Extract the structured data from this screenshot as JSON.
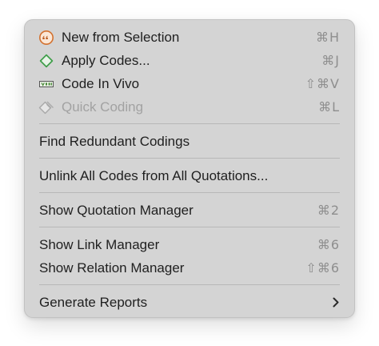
{
  "menu": {
    "items": [
      {
        "label": "New from Selection",
        "shortcut": "⌘H",
        "icon": "quote-bubble-icon",
        "enabled": true
      },
      {
        "label": "Apply Codes...",
        "shortcut": "⌘J",
        "icon": "diamond-icon",
        "enabled": true
      },
      {
        "label": "Code In Vivo",
        "shortcut": "⇧⌘V",
        "icon": "in-vivo-code-icon",
        "enabled": true
      },
      {
        "label": "Quick Coding",
        "shortcut": "⌘L",
        "icon": "quick-code-icon",
        "enabled": false
      },
      {
        "label": "Find Redundant Codings",
        "shortcut": ""
      },
      {
        "label": "Unlink All Codes from All Quotations...",
        "shortcut": ""
      },
      {
        "label": "Show Quotation Manager",
        "shortcut": "⌘2"
      },
      {
        "label": "Show Link Manager",
        "shortcut": "⌘6"
      },
      {
        "label": "Show Relation Manager",
        "shortcut": "⇧⌘6"
      },
      {
        "label": "Generate Reports",
        "shortcut": "",
        "submenu_icon": "chevron-right-icon"
      }
    ]
  },
  "colors": {
    "menu_background": "#d4d4d4",
    "text": "#1f1f1f",
    "disabled_text": "#a2a2a2",
    "shortcut_text": "#8e8e8e",
    "quote_icon_orange": "#d3712f",
    "diamond_icon_green": "#3f9e4a",
    "in_vivo_icon_green": "#4a8a3a"
  }
}
